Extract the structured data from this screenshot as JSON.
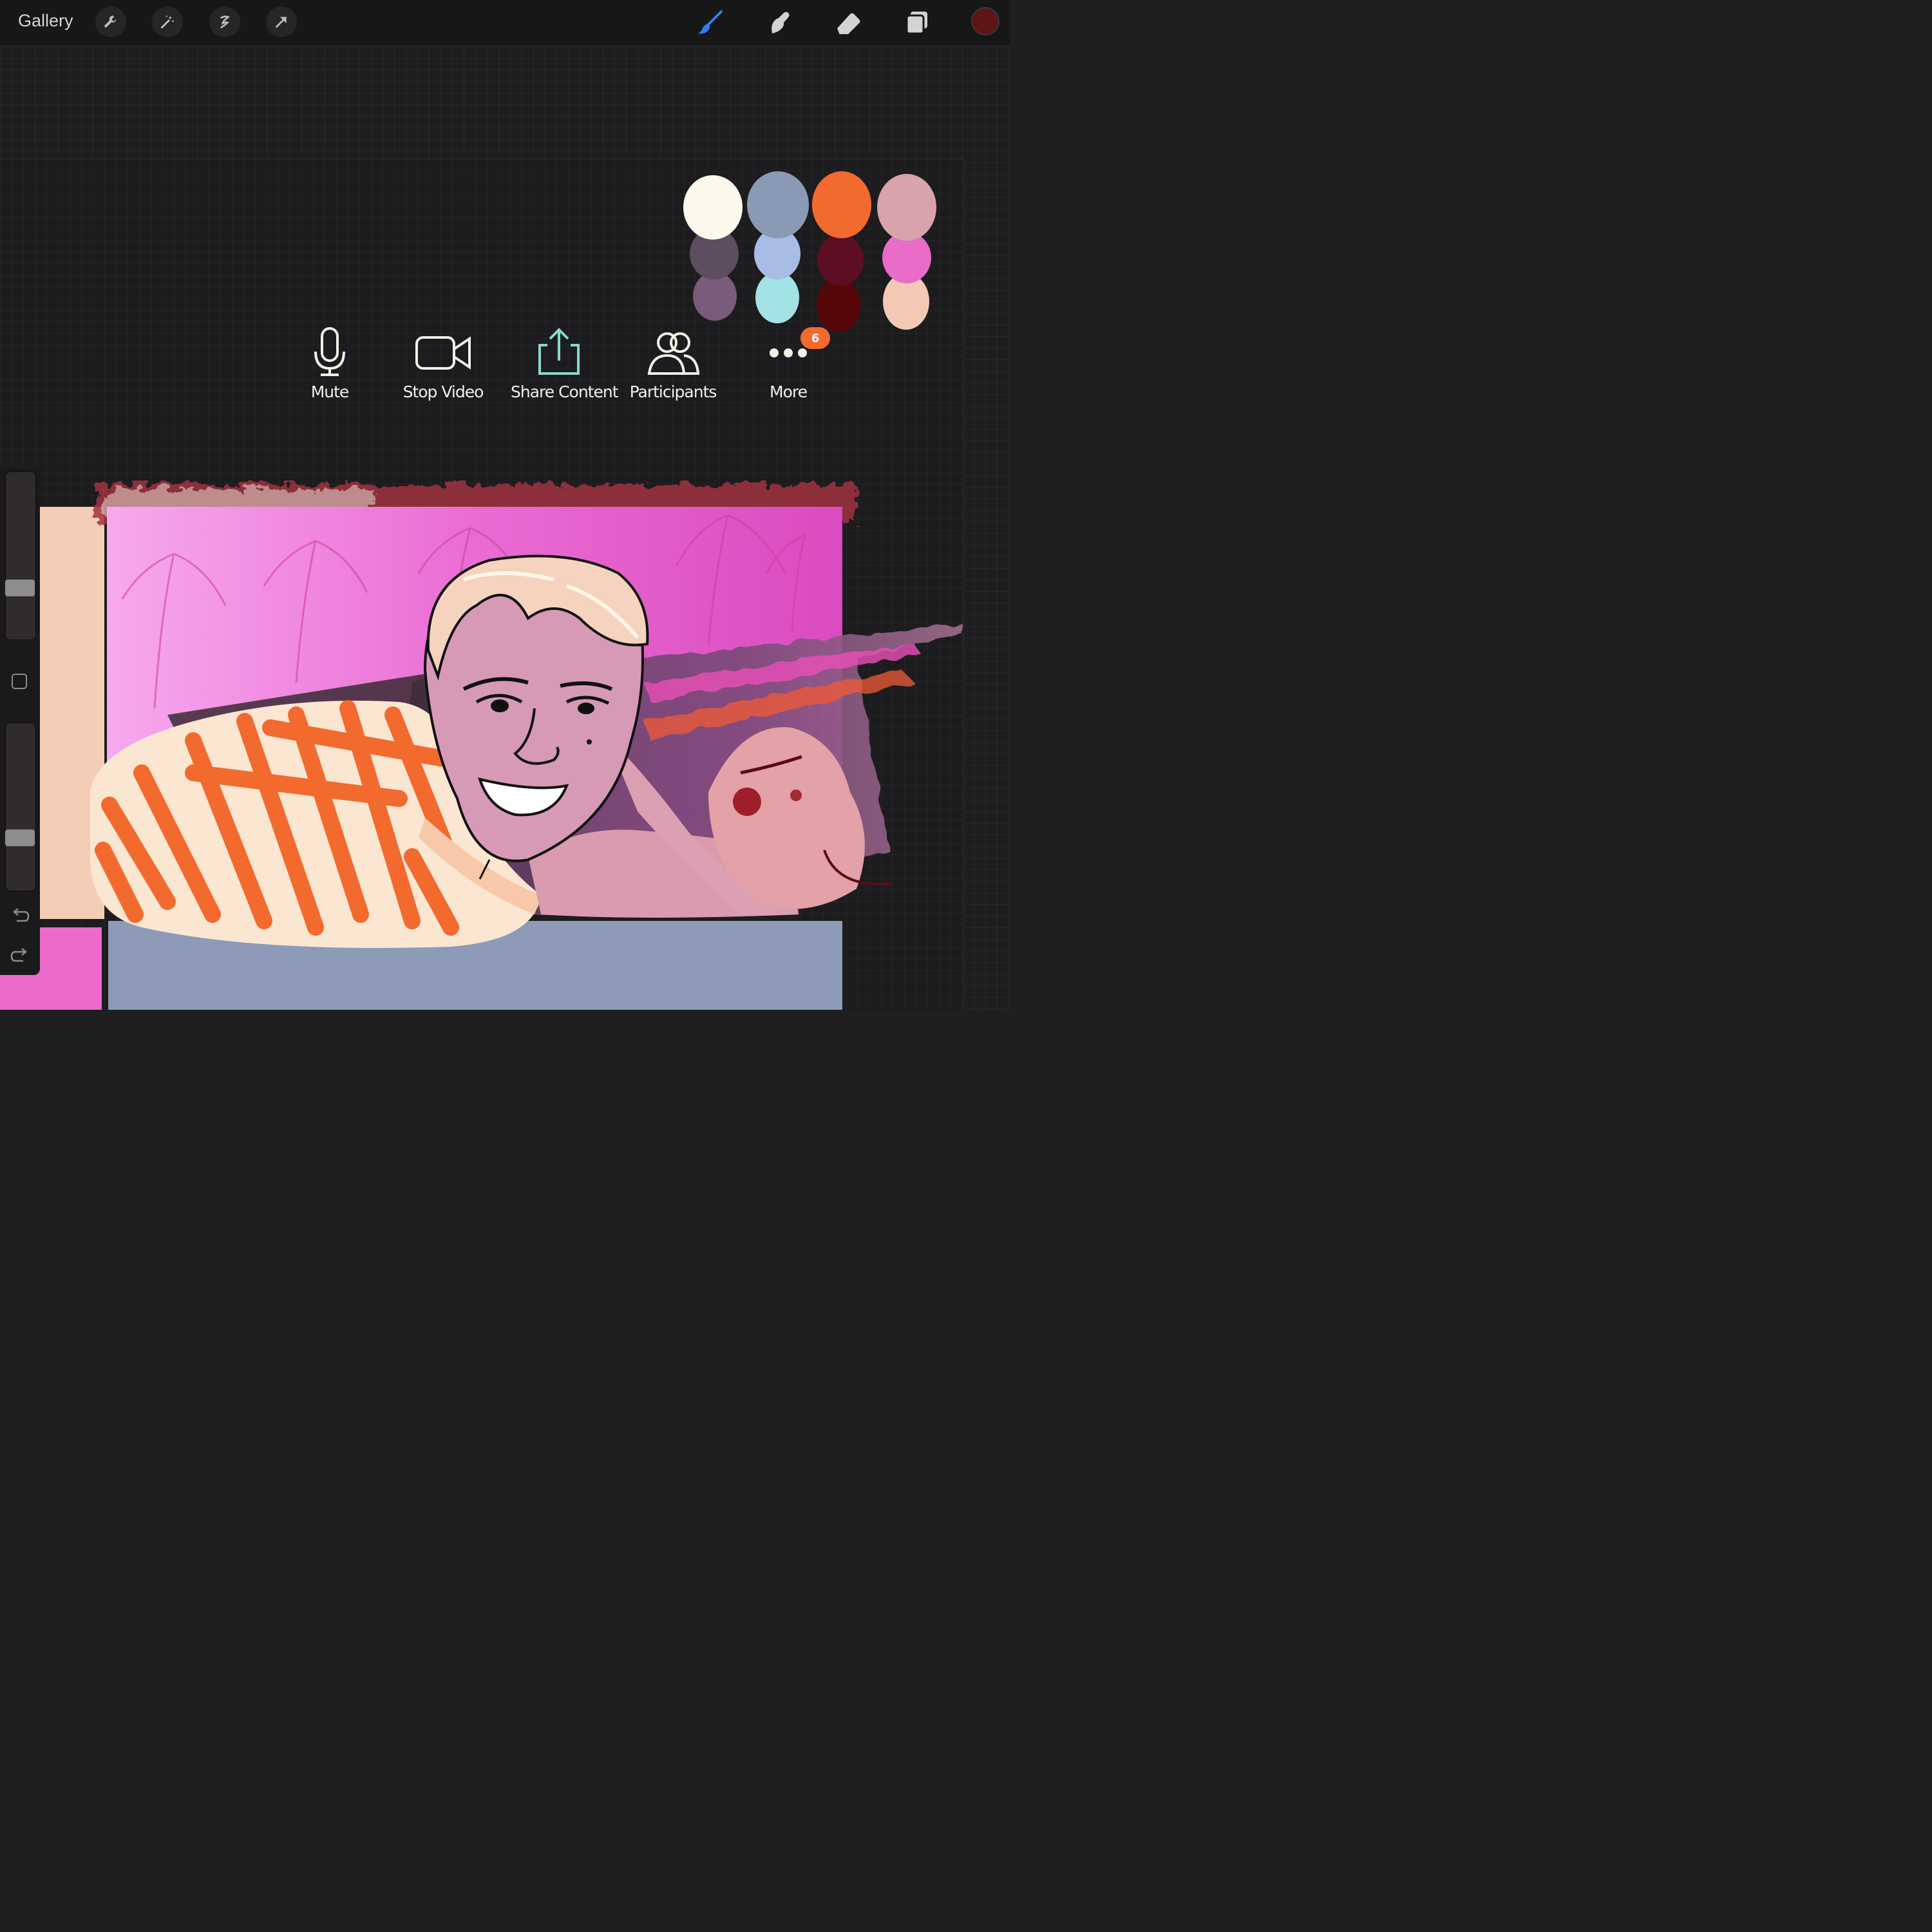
{
  "topbar": {
    "gallery_label": "Gallery",
    "left_tools": [
      "wrench-icon",
      "magic-wand-icon",
      "selection-icon",
      "move-arrow-icon"
    ],
    "right_tools": [
      "brush-icon",
      "smudge-icon",
      "eraser-icon",
      "layers-icon"
    ],
    "active_tool": "brush-icon",
    "active_color": "#5e1516",
    "accent_color": "#2f7df6"
  },
  "palette": {
    "colors": [
      "#fbf8ec",
      "#8a9ab4",
      "#f26a2e",
      "#d8a3ab",
      "#5e4c60",
      "#a9bce6",
      "#5e0e22",
      "#e86cc8",
      "#7a5c7a",
      "#a3e3e6",
      "#560608",
      "#f4c9b4"
    ]
  },
  "zoom_controls": {
    "mute": "Mute",
    "stop_video": "Stop Video",
    "share_content": "Share Content",
    "participants": "Participants",
    "more": "More",
    "more_badge": "6"
  },
  "sidebar": {
    "brush_size_level": 0.72,
    "opacity_level": 0.71,
    "modify_button_icon": "square-icon",
    "undo_icon": "undo-icon",
    "redo_icon": "redo-icon"
  }
}
